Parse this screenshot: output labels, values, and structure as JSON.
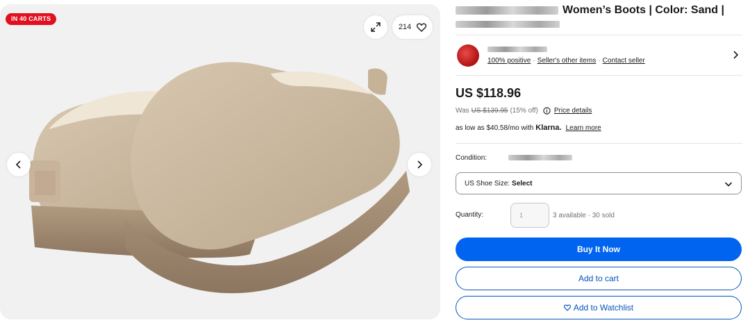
{
  "gallery": {
    "badge": "IN 40 CARTS",
    "watch_count": "214"
  },
  "listing": {
    "title_visible": "Women’s Boots | Color: Sand |",
    "seller": {
      "feedback": "100% positive",
      "other_items": "Seller's other items",
      "contact": "Contact seller"
    },
    "price": "US $118.96",
    "was_label": "Was",
    "was_price": "US $139.95",
    "discount": "(15% off)",
    "price_details": "Price details",
    "installments_prefix": "as low as $40.58/mo with",
    "installments_brand": "Klarna.",
    "installments_link": "Learn more",
    "condition_label": "Condition:",
    "size_select": {
      "label": "US Shoe Size:",
      "value": "Select"
    },
    "quantity_label": "Quantity:",
    "quantity_value": "1",
    "availability": "3 available · 30 sold",
    "buy_now": "Buy It Now",
    "add_to_cart": "Add to cart",
    "add_to_watchlist": "Add to Watchlist"
  },
  "colors": {
    "badge_red": "#e0101e",
    "buy_blue": "#0064f0",
    "outline_blue": "#0654ba"
  },
  "icons": [
    "expand-icon",
    "heart-icon",
    "chevron-left-icon",
    "chevron-right-icon",
    "info-icon",
    "chevron-down-icon"
  ]
}
